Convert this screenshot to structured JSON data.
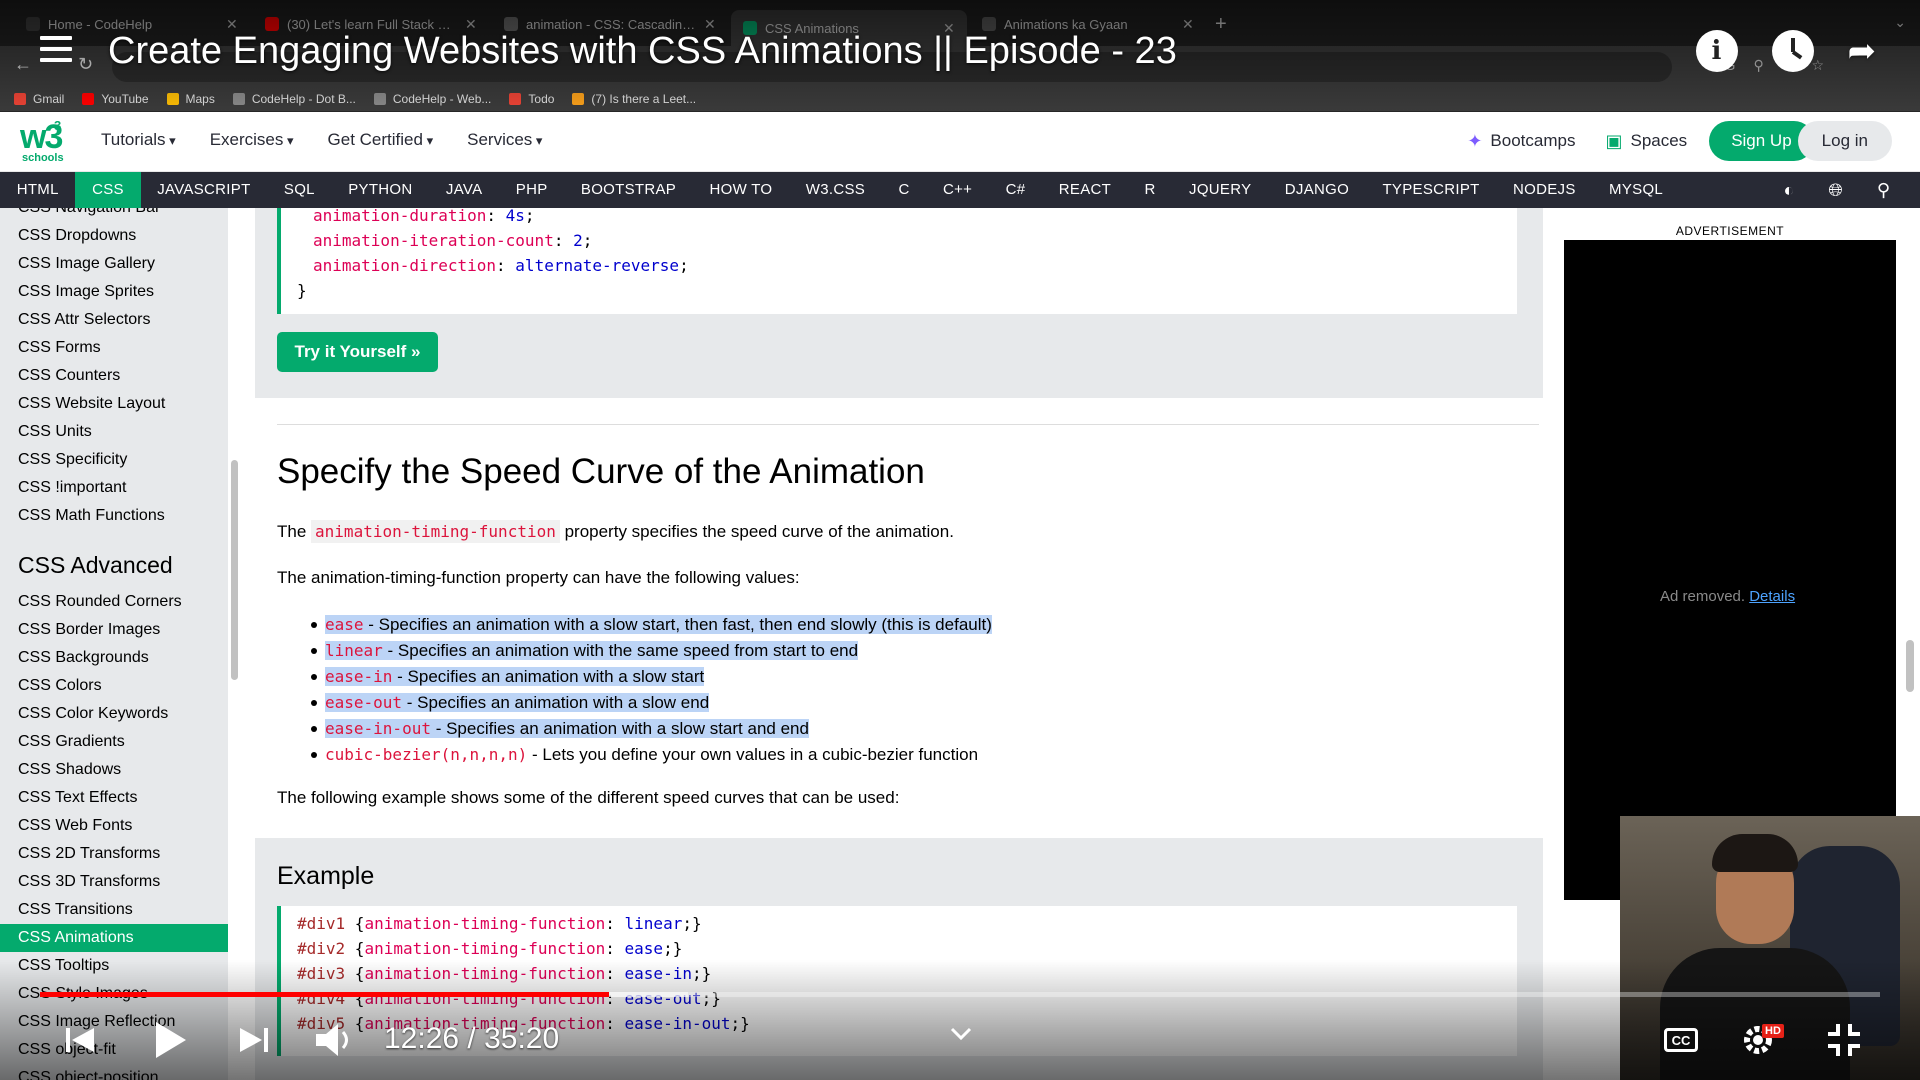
{
  "browser": {
    "tabs": [
      {
        "label": "Home - CodeHelp",
        "color": "#3a3a3a"
      },
      {
        "label": "(30) Let's learn Full Stack Web",
        "color": "#ff0000"
      },
      {
        "label": "animation - CSS: Cascading St",
        "color": "#666666"
      },
      {
        "label": "CSS Animations",
        "color": "#04aa6d"
      },
      {
        "label": "Animations ka Gyaan",
        "color": "#555555"
      }
    ],
    "active_tab_index": 3,
    "bookmarks": [
      {
        "label": "Gmail",
        "color": "#ea4335"
      },
      {
        "label": "YouTube",
        "color": "#ff0000"
      },
      {
        "label": "Maps",
        "color": "#fbbc05"
      },
      {
        "label": "CodeHelp - Dot B...",
        "color": "#888888"
      },
      {
        "label": "CodeHelp - Web...",
        "color": "#888888"
      },
      {
        "label": "Todo",
        "color": "#ea4335"
      },
      {
        "label": "(7) Is there a Leet...",
        "color": "#f89f1b"
      }
    ]
  },
  "video": {
    "title": "Create Engaging Websites with CSS Animations || Episode - 23",
    "current_time": "12:26",
    "duration": "35:20",
    "time_text": "12:26 / 35:20",
    "progress": 0.352,
    "buffered": 0.309,
    "cc_label": "CC",
    "hd_label": "HD"
  },
  "w3": {
    "logo_text": "w3",
    "logo_sup": "3",
    "logo_sub": "schools",
    "menu": [
      "Tutorials",
      "Exercises",
      "Get Certified",
      "Services"
    ],
    "bootcamps": "Bootcamps",
    "spaces": "Spaces",
    "signup": "Sign Up",
    "login": "Log in",
    "topics": [
      "HTML",
      "CSS",
      "JAVASCRIPT",
      "SQL",
      "PYTHON",
      "JAVA",
      "PHP",
      "BOOTSTRAP",
      "HOW TO",
      "W3.CSS",
      "C",
      "C++",
      "C#",
      "REACT",
      "R",
      "JQUERY",
      "DJANGO",
      "TYPESCRIPT",
      "NODEJS",
      "MYSQL"
    ],
    "active_topic": "CSS",
    "accent": "#04aa6d"
  },
  "sidebar": {
    "items_top": [
      "CSS Navigation Bar",
      "CSS Dropdowns",
      "CSS Image Gallery",
      "CSS Image Sprites",
      "CSS Attr Selectors",
      "CSS Forms",
      "CSS Counters",
      "CSS Website Layout",
      "CSS Units",
      "CSS Specificity",
      "CSS !important",
      "CSS Math Functions"
    ],
    "section_heading": "CSS Advanced",
    "items_advanced": [
      "CSS Rounded Corners",
      "CSS Border Images",
      "CSS Backgrounds",
      "CSS Colors",
      "CSS Color Keywords",
      "CSS Gradients",
      "CSS Shadows",
      "CSS Text Effects",
      "CSS Web Fonts",
      "CSS 2D Transforms",
      "CSS 3D Transforms",
      "CSS Transitions",
      "CSS Animations",
      "CSS Tooltips",
      "CSS Style Images",
      "CSS Image Reflection",
      "CSS object-fit",
      "CSS object-position"
    ],
    "active_item": "CSS Animations"
  },
  "content": {
    "code1": [
      {
        "prop": "animation-duration",
        "value": "4s"
      },
      {
        "prop": "animation-iteration-count",
        "value": "2"
      },
      {
        "prop": "animation-direction",
        "value": "alternate-reverse"
      }
    ],
    "code1_close": "}",
    "try_button": "Try it Yourself »",
    "heading": "Specify the Speed Curve of the Animation",
    "intro_before": "The ",
    "intro_code": "animation-timing-function",
    "intro_after": " property specifies the speed curve of the animation.",
    "values_intro": "The animation-timing-function property can have the following values:",
    "bullets": [
      {
        "kw": "ease",
        "text": " - Specifies an animation with a slow start, then fast, then end slowly (this is default)",
        "selected": true
      },
      {
        "kw": "linear",
        "text": " - Specifies an animation with the same speed from start to end",
        "selected": true
      },
      {
        "kw": "ease-in",
        "text": " - Specifies an animation with a slow start",
        "selected": true
      },
      {
        "kw": "ease-out",
        "text": " - Specifies an animation with a slow end",
        "selected": true
      },
      {
        "kw": "ease-in-out",
        "text": " - Specifies an animation with a slow start and end",
        "selected": true
      },
      {
        "kw": "cubic-bezier(n,n,n,n)",
        "text": " - Lets you define your own values in a cubic-bezier function",
        "selected": false
      }
    ],
    "example_intro": "The following example shows some of the different speed curves that can be used:",
    "example_heading": "Example",
    "code2": [
      {
        "sel": "#div1",
        "value": "linear"
      },
      {
        "sel": "#div2",
        "value": "ease"
      },
      {
        "sel": "#div3",
        "value": "ease-in"
      },
      {
        "sel": "#div4",
        "value": "ease-out"
      },
      {
        "sel": "#div5",
        "value": "ease-in-out"
      }
    ],
    "code2_prop": "animation-timing-function"
  },
  "ad": {
    "label": "ADVERTISEMENT",
    "removed_text": "Ad removed.",
    "details_link": "Details"
  }
}
